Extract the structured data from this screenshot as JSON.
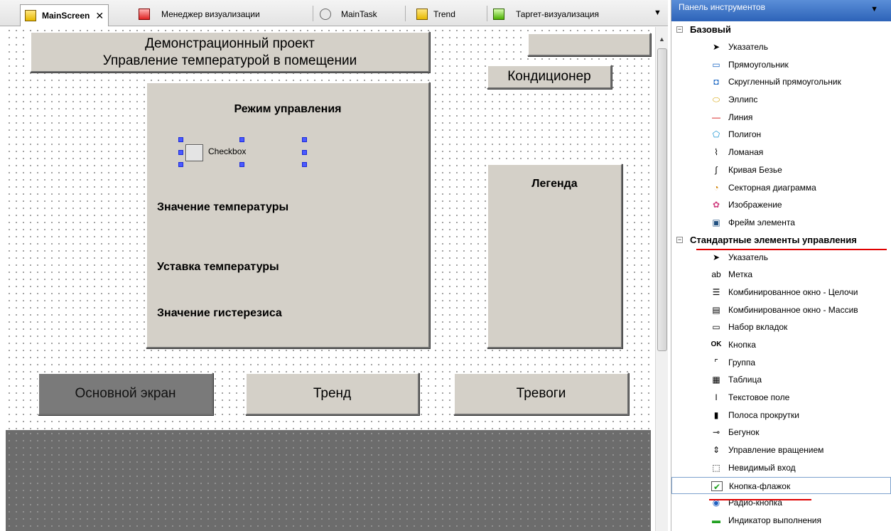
{
  "tabs": [
    {
      "label": "MainScreen",
      "active": true,
      "close": "✕"
    },
    {
      "label": "Менеджер визуализации"
    },
    {
      "label": "MainTask"
    },
    {
      "label": "Trend"
    },
    {
      "label": "Таргет-визуализация"
    }
  ],
  "canvas": {
    "title_line1": "Демонстрационный проект",
    "title_line2": "Управление температурой в помещении",
    "ac_button": "Кондиционер",
    "control_title": "Режим управления",
    "checkbox_label": "Checkbox",
    "temp_value_label": "Значение температуры",
    "temp_setpoint_label": "Уставка температуры",
    "hysteresis_label": "Значение гистерезиса",
    "legend_title": "Легенда",
    "nav": {
      "main": "Основной экран",
      "trend": "Тренд",
      "alarms": "Тревоги"
    }
  },
  "toolbox": {
    "header": "Панель инструментов",
    "groups": [
      {
        "label": "Базовый",
        "toggle": "−",
        "items": [
          {
            "label": "Указатель",
            "icon": "pointer-icon"
          },
          {
            "label": "Прямоугольник",
            "icon": "rectangle-icon"
          },
          {
            "label": "Скругленный прямоугольник",
            "icon": "rounded-rectangle-icon"
          },
          {
            "label": "Эллипс",
            "icon": "ellipse-icon"
          },
          {
            "label": "Линия",
            "icon": "line-icon"
          },
          {
            "label": "Полигон",
            "icon": "polygon-icon"
          },
          {
            "label": "Ломаная",
            "icon": "polyline-icon"
          },
          {
            "label": "Кривая Безье",
            "icon": "bezier-icon"
          },
          {
            "label": "Секторная диаграмма",
            "icon": "pie-icon"
          },
          {
            "label": "Изображение",
            "icon": "image-icon"
          },
          {
            "label": "Фрейм элемента",
            "icon": "frame-icon"
          }
        ]
      },
      {
        "label": "Стандартные элементы управления",
        "toggle": "−",
        "items": [
          {
            "label": "Указатель",
            "icon": "pointer-icon"
          },
          {
            "label": "Метка",
            "icon": "label-icon"
          },
          {
            "label": "Комбинированное окно - Целочи",
            "icon": "combobox-int-icon"
          },
          {
            "label": "Комбинированное окно - Массив",
            "icon": "combobox-array-icon"
          },
          {
            "label": "Набор вкладок",
            "icon": "tabs-icon"
          },
          {
            "label": "Кнопка",
            "icon": "button-icon"
          },
          {
            "label": "Группа",
            "icon": "group-icon"
          },
          {
            "label": "Таблица",
            "icon": "table-icon"
          },
          {
            "label": "Текстовое поле",
            "icon": "textfield-icon"
          },
          {
            "label": "Полоса прокрутки",
            "icon": "scrollbar-icon"
          },
          {
            "label": "Бегунок",
            "icon": "slider-icon"
          },
          {
            "label": "Управление вращением",
            "icon": "spin-control-icon"
          },
          {
            "label": "Невидимый вход",
            "icon": "invisible-input-icon"
          },
          {
            "label": "Кнопка-флажок",
            "icon": "checkbox-icon",
            "selected": true
          },
          {
            "label": "Радио-кнопка",
            "icon": "radio-icon"
          },
          {
            "label": "Индикатор выполнения",
            "icon": "progress-icon"
          }
        ]
      }
    ]
  }
}
